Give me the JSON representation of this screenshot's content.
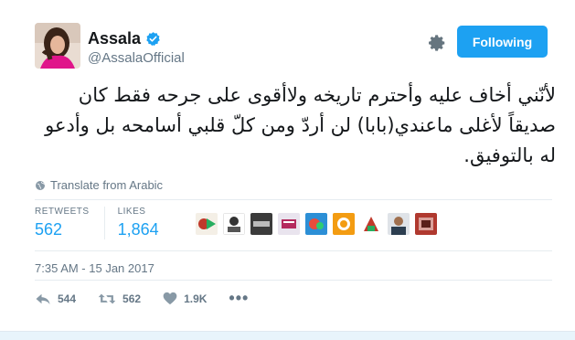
{
  "author": {
    "display_name": "Assala",
    "handle": "@AssalaOfficial",
    "verified": true
  },
  "follow_button": {
    "label": "Following"
  },
  "tweet": {
    "text_lines": [
      "لأنّني أخاف عليه وأحترم تاريخه ولاأقوى على جرحه فقط كان",
      "صديقاً لأغلى ماعندي(بابا) لن أردّ ومن كلّ قلبي أسامحه بل وأدعو",
      "له بالتوفيق."
    ],
    "translate_label": "Translate from Arabic"
  },
  "stats": {
    "retweets_label": "RETWEETS",
    "retweets_value": "562",
    "likes_label": "LIKES",
    "likes_value": "1,864"
  },
  "timestamp": "7:35 AM - 15 Jan 2017",
  "actions": {
    "reply_count": "544",
    "retweet_count": "562",
    "like_count": "1.9K"
  },
  "colors": {
    "accent": "#1da1f2",
    "muted": "#657786",
    "text": "#14171a"
  },
  "icons": [
    "verified-badge-icon",
    "gear-icon",
    "globe-icon",
    "reply-icon",
    "retweet-icon",
    "heart-icon",
    "more-icon"
  ]
}
